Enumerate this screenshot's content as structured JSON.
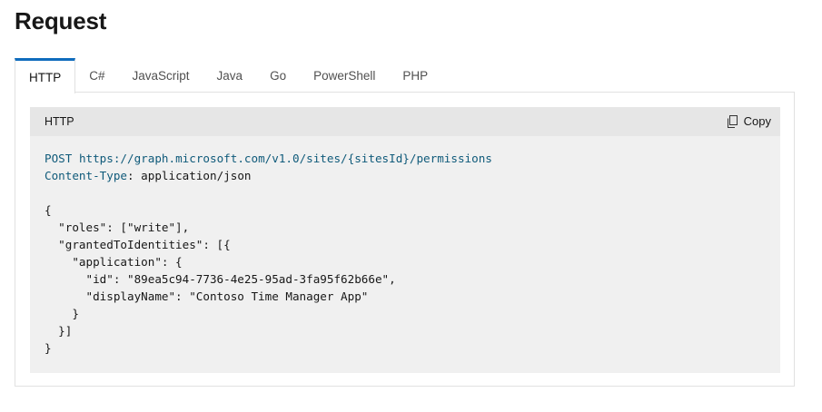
{
  "page": {
    "title": "Request"
  },
  "tabs": [
    {
      "label": "HTTP",
      "active": true
    },
    {
      "label": "C#"
    },
    {
      "label": "JavaScript"
    },
    {
      "label": "Java"
    },
    {
      "label": "Go"
    },
    {
      "label": "PowerShell"
    },
    {
      "label": "PHP"
    }
  ],
  "code_block": {
    "language_label": "HTTP",
    "copy_label": "Copy",
    "copy_icon": "copy-icon",
    "request_method": "POST",
    "request_url": "https://graph.microsoft.com/v1.0/sites/{sitesId}/permissions",
    "header_name": "Content-Type",
    "header_value": ": application/json",
    "body": "\n{\n  \"roles\": [\"write\"],\n  \"grantedToIdentities\": [{\n    \"application\": {\n      \"id\": \"89ea5c94-7736-4e25-95ad-3fa95f62b66e\",\n      \"displayName\": \"Contoso Time Manager App\"\n    }\n  }]\n}"
  },
  "colors": {
    "accent": "#0f6cbd",
    "code_keyword": "#0f5a7a",
    "code_bg": "#f0f0f0",
    "code_header_bg": "#e6e6e6"
  }
}
